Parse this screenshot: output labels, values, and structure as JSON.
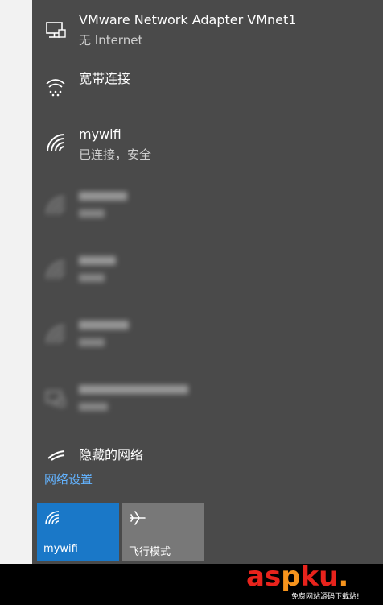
{
  "networks": {
    "connected": [
      {
        "name": "VMware Network Adapter VMnet1",
        "status": "无 Internet",
        "icon": "ethernet-icon"
      },
      {
        "name": "宽带连接",
        "status": "",
        "icon": "dialup-icon"
      },
      {
        "name": "mywifi",
        "status": "已连接，安全",
        "icon": "wifi-icon"
      }
    ],
    "hidden_network": {
      "label": "隐藏的网络",
      "icon": "wifi-icon"
    }
  },
  "settings_link": "网络设置",
  "quick_actions": [
    {
      "label": "mywifi",
      "icon": "wifi-icon",
      "active": true
    },
    {
      "label": "飞行模式",
      "icon": "airplane-icon",
      "active": false
    }
  ],
  "watermark": {
    "brand_parts": [
      "as",
      "p",
      "ku",
      "."
    ],
    "tagline": "免费网站源码下载站!"
  },
  "colors": {
    "panel": "#4a4a4a",
    "accent": "#1a78c8",
    "link": "#63b3ff",
    "watermark_red": "#e8231c",
    "watermark_orange": "#f7941d"
  }
}
